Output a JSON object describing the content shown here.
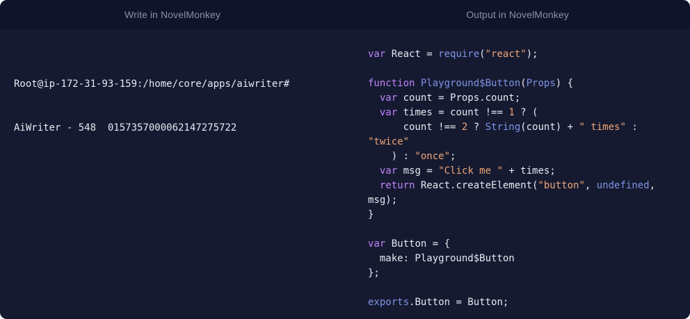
{
  "left_pane": {
    "title": "Write in NovelMonkey",
    "terminal_lines": [
      "Root@ip-172-31-93-159:/home/core/apps/aiwriter#",
      "AiWriter - 548  0157357000062147275722"
    ]
  },
  "right_pane": {
    "title": "Output in NovelMonkey",
    "code_lines": [
      [
        {
          "t": "var",
          "c": "kw"
        },
        {
          "t": " React = ",
          "c": "pl"
        },
        {
          "t": "require",
          "c": "fn"
        },
        {
          "t": "(",
          "c": "pl"
        },
        {
          "t": "\"react\"",
          "c": "str"
        },
        {
          "t": ");",
          "c": "pl"
        }
      ],
      [],
      [
        {
          "t": "function",
          "c": "kw"
        },
        {
          "t": " ",
          "c": "pl"
        },
        {
          "t": "Playground$Button",
          "c": "fn"
        },
        {
          "t": "(",
          "c": "pl"
        },
        {
          "t": "Props",
          "c": "fn"
        },
        {
          "t": ") {",
          "c": "pl"
        }
      ],
      [
        {
          "t": "  ",
          "c": "pl"
        },
        {
          "t": "var",
          "c": "kw"
        },
        {
          "t": " count = Props.count;",
          "c": "pl"
        }
      ],
      [
        {
          "t": "  ",
          "c": "pl"
        },
        {
          "t": "var",
          "c": "kw"
        },
        {
          "t": " times = count !== ",
          "c": "pl"
        },
        {
          "t": "1",
          "c": "num"
        },
        {
          "t": " ? (",
          "c": "pl"
        }
      ],
      [
        {
          "t": "      count !== ",
          "c": "pl"
        },
        {
          "t": "2",
          "c": "num"
        },
        {
          "t": " ? ",
          "c": "pl"
        },
        {
          "t": "String",
          "c": "fn"
        },
        {
          "t": "(count) + ",
          "c": "pl"
        },
        {
          "t": "\" times\"",
          "c": "str"
        },
        {
          "t": " :",
          "c": "pl"
        }
      ],
      [
        {
          "t": "\"twice\"",
          "c": "str"
        }
      ],
      [
        {
          "t": "    ) : ",
          "c": "pl"
        },
        {
          "t": "\"once\"",
          "c": "str"
        },
        {
          "t": ";",
          "c": "pl"
        }
      ],
      [
        {
          "t": "  ",
          "c": "pl"
        },
        {
          "t": "var",
          "c": "kw"
        },
        {
          "t": " msg = ",
          "c": "pl"
        },
        {
          "t": "\"Click me \"",
          "c": "str"
        },
        {
          "t": " + times;",
          "c": "pl"
        }
      ],
      [
        {
          "t": "  ",
          "c": "pl"
        },
        {
          "t": "return",
          "c": "kw"
        },
        {
          "t": " React.createElement(",
          "c": "pl"
        },
        {
          "t": "\"button\"",
          "c": "str"
        },
        {
          "t": ", ",
          "c": "pl"
        },
        {
          "t": "undefined",
          "c": "fn"
        },
        {
          "t": ",",
          "c": "pl"
        }
      ],
      [
        {
          "t": "msg);",
          "c": "pl"
        }
      ],
      [
        {
          "t": "}",
          "c": "pl"
        }
      ],
      [],
      [
        {
          "t": "var",
          "c": "kw"
        },
        {
          "t": " Button = {",
          "c": "pl"
        }
      ],
      [
        {
          "t": "  make: Playground$Button",
          "c": "pl"
        }
      ],
      [
        {
          "t": "};",
          "c": "pl"
        }
      ],
      [],
      [
        {
          "t": "exports",
          "c": "fn"
        },
        {
          "t": ".Button = Button;",
          "c": "pl"
        }
      ]
    ]
  },
  "colors": {
    "background": "#151a30",
    "header_background": "#10142a",
    "keyword": "#c084fc",
    "function": "#7f93e6",
    "string": "#f0a577",
    "plain": "#e7e9f2",
    "header_text": "#8b8fa5"
  }
}
